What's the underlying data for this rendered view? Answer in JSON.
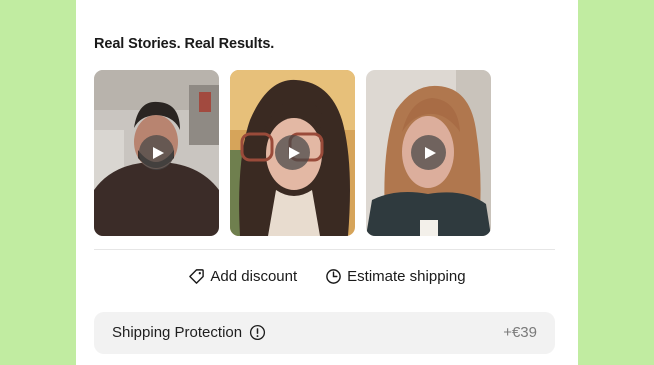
{
  "section": {
    "title": "Real Stories. Real Results."
  },
  "videos": [
    {
      "label": "testimonial-video-1"
    },
    {
      "label": "testimonial-video-2"
    },
    {
      "label": "testimonial-video-3"
    }
  ],
  "actions": {
    "add_discount": "Add discount",
    "estimate_shipping": "Estimate shipping"
  },
  "shipping_protection": {
    "label": "Shipping Protection",
    "price": "+€39"
  },
  "colors": {
    "background": "#c1eca1",
    "panel": "#ffffff",
    "protection_bg": "#f2f2f2"
  },
  "icons": [
    "play-icon",
    "tag-icon",
    "clock-icon",
    "info-icon"
  ]
}
